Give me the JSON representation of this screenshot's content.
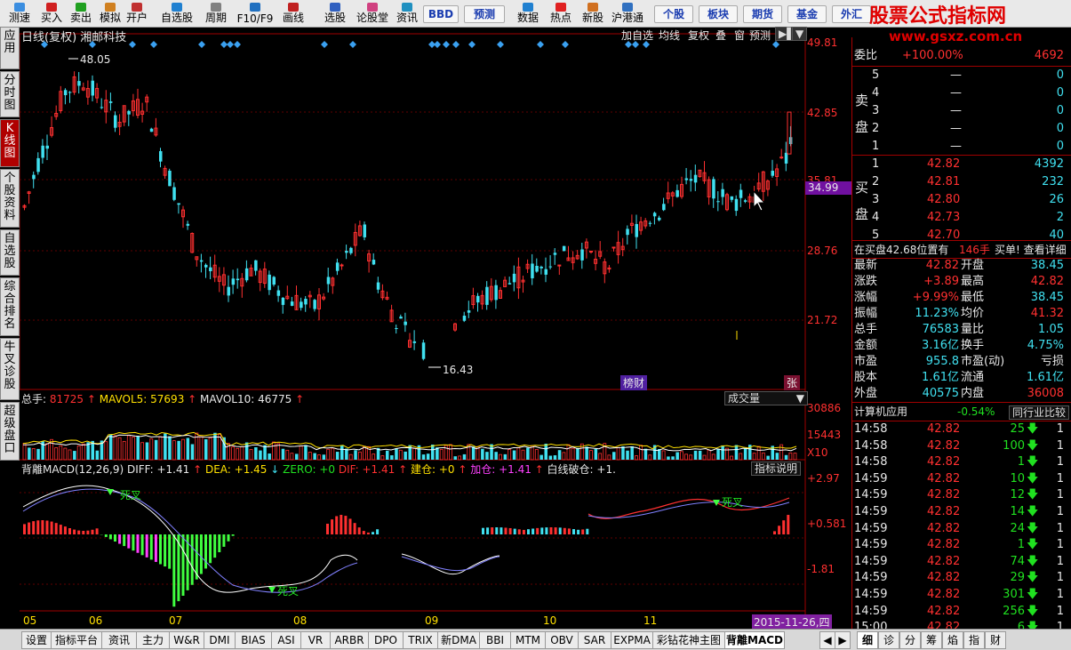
{
  "toolbar": {
    "items": [
      "测速",
      "买入",
      "卖出",
      "模拟",
      "开户",
      "自选股",
      "周期",
      "F10/F9",
      "画线",
      "选股",
      "论股堂",
      "资讯",
      "BBD",
      "预测",
      "数据",
      "热点",
      "新股",
      "沪港通",
      "个股",
      "板块",
      "期货",
      "基金",
      "外汇"
    ]
  },
  "brand": {
    "title": "股票公式指标网",
    "url": "www.gsxz.com.cn"
  },
  "left_tabs": [
    "应用",
    "分时图",
    "K线图",
    "个股资料",
    "自选股",
    "综合排名",
    "牛叉诊股",
    "超级盘口"
  ],
  "chart": {
    "header": "日线(复权) 湘邮科技",
    "header_buttons": [
      "加自选",
      "均线",
      "复权",
      "叠",
      "窗",
      "预测"
    ],
    "price_axis": [
      "49.81",
      "42.85",
      "35.81",
      "28.76",
      "21.72"
    ],
    "current_price_tag": "34.99",
    "high_label": "48.05",
    "low_label": "16.43",
    "badge_bangcai": "榜财",
    "badge_zhang": "张",
    "volume": {
      "zongshou_label": "总手: ",
      "zongshou": "81725",
      "ma5_label": "MAVOL5: ",
      "ma5": "57693",
      "ma10_label": "MAVOL10: ",
      "ma10": "46775",
      "axis": [
        "30886",
        "15443",
        "X10"
      ],
      "dropdown": "成交量"
    },
    "macd": {
      "title": "背離MACD(12,26,9)",
      "diff_label": "DIFF: ",
      "diff": "+1.41",
      "dea_label": "DEA: ",
      "dea": "+1.45",
      "zero_label": "ZERO: ",
      "zero": "+0",
      "dif_label": "DIF: ",
      "dif": "+1.41",
      "jiancang_label": "建仓: ",
      "jiancang": "+0",
      "jiacang_label": "加仓: ",
      "jiacang": "+1.41",
      "baixian_label": "白线破仓: ",
      "baixian": "+1.",
      "axis": [
        "+2.97",
        "+0.581",
        "-1.81"
      ],
      "button": "指标说明",
      "dead_cross": "死叉"
    },
    "dates": [
      "05",
      "06",
      "07",
      "08",
      "09",
      "10",
      "11"
    ],
    "cursor_date": "2015-11-26,四"
  },
  "orderbook": {
    "weibi_label": "委比",
    "weibi": "+100.00%",
    "weibi_val": "4692",
    "sell_label": "卖盘",
    "sells": [
      {
        "lvl": "5",
        "p": "—",
        "v": "0"
      },
      {
        "lvl": "4",
        "p": "—",
        "v": "0"
      },
      {
        "lvl": "3",
        "p": "—",
        "v": "0"
      },
      {
        "lvl": "2",
        "p": "—",
        "v": "0"
      },
      {
        "lvl": "1",
        "p": "—",
        "v": "0"
      }
    ],
    "buy_label": "买盘",
    "buys": [
      {
        "lvl": "1",
        "p": "42.82",
        "v": "4392"
      },
      {
        "lvl": "2",
        "p": "42.81",
        "v": "232"
      },
      {
        "lvl": "3",
        "p": "42.80",
        "v": "26"
      },
      {
        "lvl": "4",
        "p": "42.73",
        "v": "2"
      },
      {
        "lvl": "5",
        "p": "42.70",
        "v": "40"
      }
    ],
    "notice_a": "在买盘42.68位置有",
    "notice_b": "146手",
    "notice_c": "买单! 查看详细"
  },
  "stats": [
    {
      "l": "最新",
      "v": "42.82",
      "l2": "开盘",
      "v2": "38.45"
    },
    {
      "l": "涨跌",
      "v": "+3.89",
      "l2": "最高",
      "v2": "42.82"
    },
    {
      "l": "涨幅",
      "v": "+9.99%",
      "l2": "最低",
      "v2": "38.45"
    },
    {
      "l": "振幅",
      "v": "11.23%",
      "l2": "均价",
      "v2": "41.32"
    },
    {
      "l": "总手",
      "v": "76583",
      "l2": "量比",
      "v2": "1.05"
    },
    {
      "l": "金额",
      "v": "3.16亿",
      "l2": "换手",
      "v2": "4.75%"
    },
    {
      "l": "市盈",
      "v": "955.8",
      "l2": "市盈(动)",
      "v2": "亏损"
    },
    {
      "l": "股本",
      "v": "1.61亿",
      "l2": "流通",
      "v2": "1.61亿"
    },
    {
      "l": "外盘",
      "v": "40575",
      "l2": "内盘",
      "v2": "36008"
    }
  ],
  "industry": {
    "name": "计算机应用",
    "change": "-0.54%",
    "button": "同行业比较"
  },
  "ticks": [
    {
      "t": "14:58",
      "p": "42.82",
      "v": "25",
      "n": "1"
    },
    {
      "t": "14:58",
      "p": "42.82",
      "v": "100",
      "n": "1"
    },
    {
      "t": "14:58",
      "p": "42.82",
      "v": "1",
      "n": "1"
    },
    {
      "t": "14:59",
      "p": "42.82",
      "v": "10",
      "n": "1"
    },
    {
      "t": "14:59",
      "p": "42.82",
      "v": "12",
      "n": "1"
    },
    {
      "t": "14:59",
      "p": "42.82",
      "v": "14",
      "n": "1"
    },
    {
      "t": "14:59",
      "p": "42.82",
      "v": "24",
      "n": "1"
    },
    {
      "t": "14:59",
      "p": "42.82",
      "v": "1",
      "n": "1"
    },
    {
      "t": "14:59",
      "p": "42.82",
      "v": "74",
      "n": "1"
    },
    {
      "t": "14:59",
      "p": "42.82",
      "v": "29",
      "n": "1"
    },
    {
      "t": "14:59",
      "p": "42.82",
      "v": "301",
      "n": "1"
    },
    {
      "t": "14:59",
      "p": "42.82",
      "v": "256",
      "n": "1"
    },
    {
      "t": "15:00",
      "p": "42.82",
      "v": "6",
      "n": "1"
    }
  ],
  "bottom_tabs": [
    "设置",
    "指标平台",
    "资讯",
    "主力",
    "W&R",
    "DMI",
    "BIAS",
    "ASI",
    "VR",
    "ARBR",
    "DPO",
    "TRIX",
    "新DMA",
    "BBI",
    "MTM",
    "OBV",
    "SAR",
    "EXPMA",
    "彩钻花神主图",
    "背離MACD"
  ],
  "right_tabs": [
    "细",
    "诊",
    "分",
    "筹",
    "焰",
    "指",
    "财"
  ],
  "colors": {
    "up": "#ff3030",
    "down": "#40e0f0",
    "bg": "#000000",
    "grid": "#a00000"
  }
}
